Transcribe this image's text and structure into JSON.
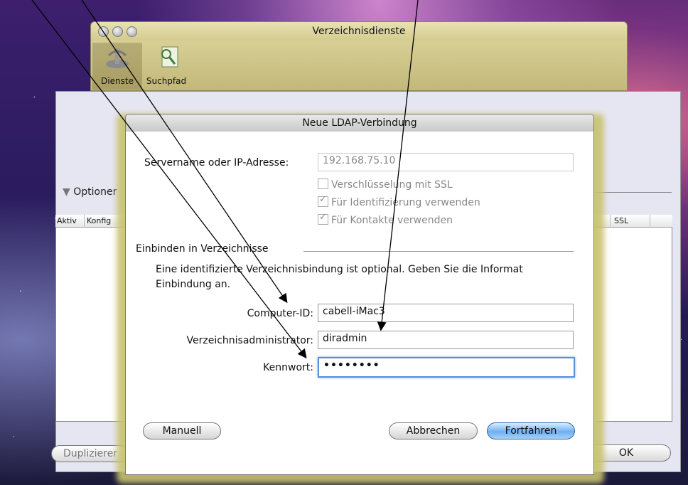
{
  "window": {
    "title": "Verzeichnisdienste",
    "toolbar": [
      {
        "label": "Dienste",
        "icon": "services-icon"
      },
      {
        "label": "Suchpfad",
        "icon": "search-path-icon"
      }
    ],
    "options_label": "Optioner",
    "table_headers": [
      "Aktiv",
      "Konfig",
      "SSL"
    ],
    "duplicate_label": "Duplizierer",
    "ok_label": "OK"
  },
  "dialog": {
    "title": "Neue LDAP-Verbindung",
    "server_label": "Servername oder IP-Adresse:",
    "server_value": "192.168.75.10",
    "checkboxes": [
      {
        "label": "Verschlüsselung mit SSL",
        "checked": false
      },
      {
        "label": "Für Identifizierung verwenden",
        "checked": true
      },
      {
        "label": "Für Kontakte verwenden",
        "checked": true
      }
    ],
    "section_title": "Einbinden in Verzeichnisse",
    "info_line1": "Eine identifizierte Verzeichnisbindung ist optional. Geben Sie die Informat",
    "info_line2": "Einbindung an.",
    "computer_id_label": "Computer-ID:",
    "computer_id_value": "cabell-iMac3",
    "admin_label": "Verzeichnisadministrator:",
    "admin_value": "diradmin",
    "password_label": "Kennwort:",
    "password_value": "••••••••",
    "manual_button": "Manuell",
    "cancel_button": "Abbrechen",
    "continue_button": "Fortfahren"
  },
  "colors": {
    "toolbar": "#d4cb8e",
    "primary_button": "#6fb0f0",
    "focus_ring": "#5b8fd9"
  }
}
